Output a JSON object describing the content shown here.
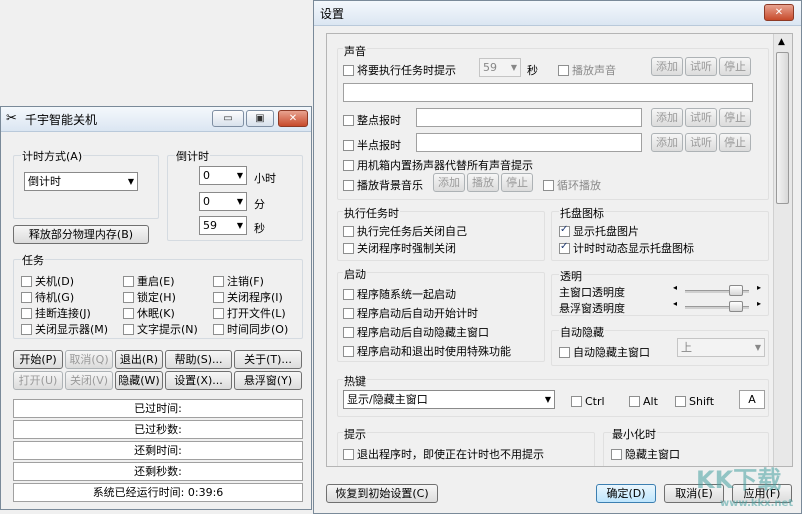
{
  "main_window": {
    "title": "千宇智能关机",
    "timing_mode": {
      "label": "计时方式(A)",
      "value": "倒计时"
    },
    "countdown": {
      "label": "倒计时",
      "hours": "0",
      "hours_unit": "小时",
      "minutes": "0",
      "minutes_unit": "分",
      "seconds": "59",
      "seconds_unit": "秒"
    },
    "release_memory_button": "释放部分物理内存(B)",
    "tasks": {
      "label": "任务",
      "items": [
        {
          "label": "关机(D)",
          "checked": false
        },
        {
          "label": "重启(E)",
          "checked": false
        },
        {
          "label": "注销(F)",
          "checked": false
        },
        {
          "label": "待机(G)",
          "checked": false
        },
        {
          "label": "锁定(H)",
          "checked": false
        },
        {
          "label": "关闭程序(I)",
          "checked": false
        },
        {
          "label": "挂断连接(J)",
          "checked": false
        },
        {
          "label": "休眠(K)",
          "checked": false
        },
        {
          "label": "打开文件(L)",
          "checked": false
        },
        {
          "label": "关闭显示器(M)",
          "checked": false
        },
        {
          "label": "文字提示(N)",
          "checked": false
        },
        {
          "label": "时间同步(O)",
          "checked": false
        }
      ]
    },
    "buttons_row1": [
      {
        "label": "开始(P)",
        "enabled": true
      },
      {
        "label": "取消(Q)",
        "enabled": false
      },
      {
        "label": "退出(R)",
        "enabled": true
      },
      {
        "label": "帮助(S)...",
        "enabled": true
      },
      {
        "label": "关于(T)...",
        "enabled": true
      }
    ],
    "buttons_row2": [
      {
        "label": "打开(U)",
        "enabled": false
      },
      {
        "label": "关闭(V)",
        "enabled": false
      },
      {
        "label": "隐藏(W)",
        "enabled": true
      },
      {
        "label": "设置(X)...",
        "enabled": true
      },
      {
        "label": "悬浮窗(Y)",
        "enabled": true
      }
    ],
    "status": {
      "elapsed_time": "已过时间:",
      "elapsed_seconds": "已过秒数:",
      "remaining_time": "还剩时间:",
      "remaining_seconds": "还剩秒数:",
      "system_uptime": "系统已经运行时间: 0:39:6"
    }
  },
  "settings_window": {
    "title": "设置",
    "sound": {
      "label": "声音",
      "pre_task_prompt": "将要执行任务时提示",
      "seconds_value": "59",
      "seconds_unit": "秒",
      "play_sound": "播放声音",
      "add": "添加",
      "listen": "试听",
      "stop": "停止",
      "hourly_chime": "整点报时",
      "half_hour_chime": "半点报时",
      "use_speaker": "用机箱内置扬声器代替所有声音提示",
      "play_bg_music": "播放背景音乐",
      "play": "播放",
      "loop_play": "循环播放"
    },
    "execute_task": {
      "label": "执行任务时",
      "close_self": "执行完任务后关闭自己",
      "force_close": "关闭程序时强制关闭"
    },
    "tray_icon": {
      "label": "托盘图标",
      "show_tray": "显示托盘图片",
      "show_tray_checked": true,
      "dynamic_tray": "计时时动态显示托盘图标",
      "dynamic_tray_checked": true
    },
    "startup": {
      "label": "启动",
      "start_with_system": "程序随系统一起启动",
      "start_timing": "程序启动后自动开始计时",
      "hide_main": "程序启动后自动隐藏主窗口",
      "special_func": "程序启动和退出时使用特殊功能"
    },
    "transparency": {
      "label": "透明",
      "main_window": "主窗口透明度",
      "float_window": "悬浮窗透明度"
    },
    "auto_hide": {
      "label": "自动隐藏",
      "hide_main": "自动隐藏主窗口",
      "position_value": "上"
    },
    "hotkey": {
      "label": "热键",
      "action_value": "显示/隐藏主窗口",
      "ctrl": "Ctrl",
      "alt": "Alt",
      "shift": "Shift",
      "key": "A"
    },
    "prompt": {
      "label": "提示",
      "exit_prompt": "退出程序时，即使正在计时也不用提示"
    },
    "minimize": {
      "label": "最小化时",
      "hide_main": "隐藏主窗口"
    },
    "buttons": {
      "restore_defaults": "恢复到初始设置(C)",
      "ok": "确定(D)",
      "cancel": "取消(E)",
      "apply": "应用(F)"
    }
  },
  "watermark": {
    "logo": "KK下载",
    "url": "www.kkx.net"
  }
}
